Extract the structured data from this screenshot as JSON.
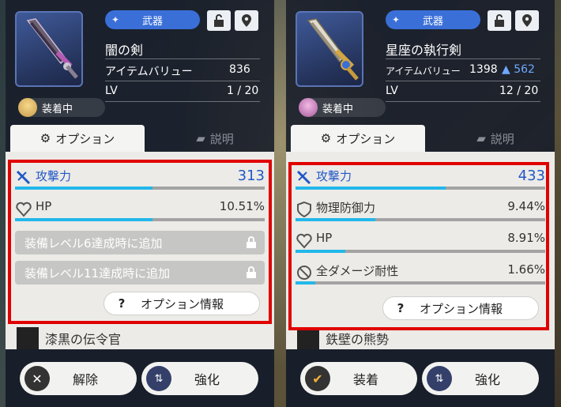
{
  "left": {
    "category": "武器",
    "name": "闇の剣",
    "item_value_label": "アイテムバリュー",
    "item_value": "836",
    "level_label": "LV",
    "level": "1 / 20",
    "equipped_label": "装着中",
    "tab_option": "オプション",
    "tab_desc": "説明",
    "stats": [
      {
        "label": "攻撃力",
        "value": "313",
        "fill": 0.55
      },
      {
        "label": "HP",
        "value": "10.51%",
        "fill": 0.55
      }
    ],
    "locked": [
      "装備レベル6達成時に追加",
      "装備レベル11達成時に追加"
    ],
    "option_info": "オプション情報",
    "peek_text": "漆黒の伝令官",
    "btn_release": "解除",
    "btn_enhance": "強化"
  },
  "right": {
    "category": "武器",
    "name": "星座の執行剣",
    "item_value_label": "アイテムバリュー",
    "item_value": "1398",
    "item_value_delta": "▲ 562",
    "level_label": "LV",
    "level": "12 / 20",
    "equipped_label": "装着中",
    "tab_option": "オプション",
    "tab_desc": "説明",
    "stats": [
      {
        "label": "攻撃力",
        "value": "433",
        "fill": 0.6
      },
      {
        "label": "物理防御力",
        "value": "9.44%",
        "fill": 0.32
      },
      {
        "label": "HP",
        "value": "8.91%",
        "fill": 0.2
      },
      {
        "label": "全ダメージ耐性",
        "value": "1.66%",
        "fill": 0.08
      }
    ],
    "option_info": "オプション情報",
    "peek_text": "鉄壁の熊勢",
    "btn_equip": "装着",
    "btn_enhance": "強化"
  },
  "colors": {
    "accent": "#22b8ea",
    "main_stat": "#2257c7",
    "highlight": "#e00000",
    "badge": "#3a6fd8"
  }
}
